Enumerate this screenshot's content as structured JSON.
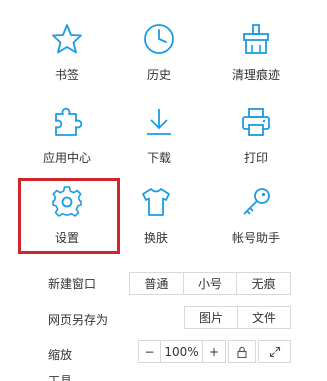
{
  "accent_color": "#1b9ce2",
  "highlight_color": "#d0262b",
  "grid": [
    {
      "label": "书签",
      "icon": "star-icon"
    },
    {
      "label": "历史",
      "icon": "clock-icon"
    },
    {
      "label": "清理痕迹",
      "icon": "broom-icon"
    },
    {
      "label": "应用中心",
      "icon": "puzzle-icon"
    },
    {
      "label": "下载",
      "icon": "download-icon"
    },
    {
      "label": "打印",
      "icon": "printer-icon"
    },
    {
      "label": "设置",
      "icon": "gear-icon"
    },
    {
      "label": "换肤",
      "icon": "shirt-icon"
    },
    {
      "label": "帐号助手",
      "icon": "key-icon"
    }
  ],
  "new_window": {
    "label": "新建窗口",
    "options": [
      "普通",
      "小号",
      "无痕"
    ]
  },
  "save_page": {
    "label": "网页另存为",
    "options": [
      "图片",
      "文件"
    ]
  },
  "zoom": {
    "label": "缩放",
    "minus": "−",
    "value": "100%",
    "plus": "+",
    "lock_icon": "lock-icon",
    "fullscreen_icon": "fullscreen-icon"
  },
  "cut_row_label": "工具"
}
